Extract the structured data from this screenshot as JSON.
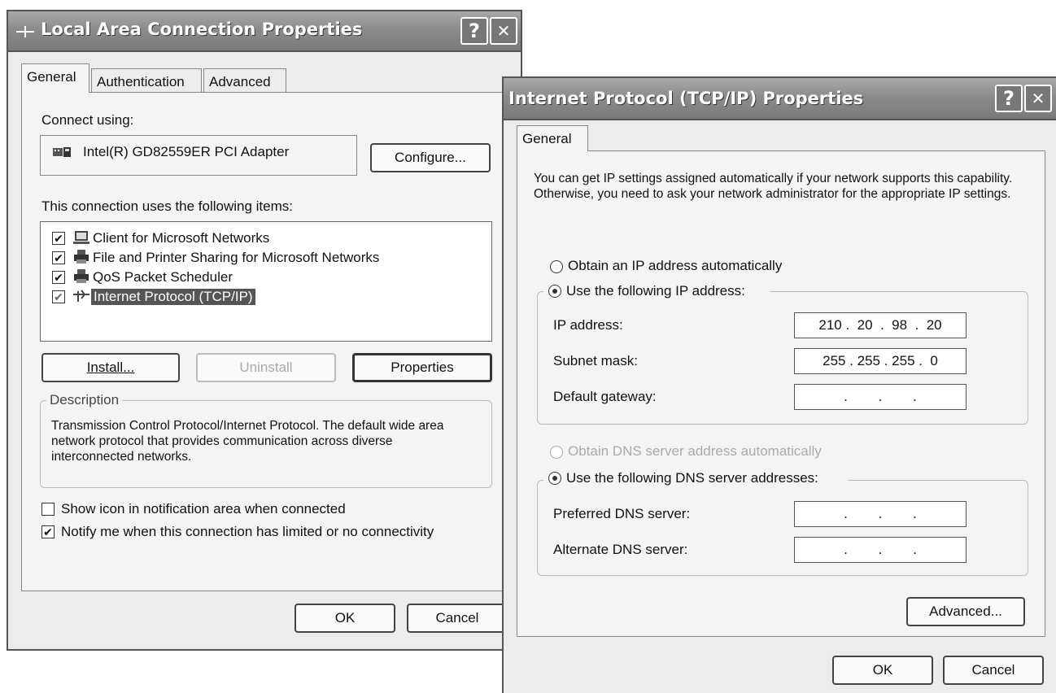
{
  "lac": {
    "title": "Local Area Connection Properties",
    "help_btn": "?",
    "close_btn": "✕",
    "tabs": [
      "General",
      "Authentication",
      "Advanced"
    ],
    "connect_using_label": "Connect using:",
    "adapter_name": "Intel(R) GD82559ER PCI Adapter",
    "configure_btn": "Configure...",
    "items_label": "This connection uses the following items:",
    "items": [
      {
        "label": "Client for Microsoft Networks",
        "checked": true,
        "icon": "computer-icon"
      },
      {
        "label": "File and Printer Sharing for Microsoft Networks",
        "checked": true,
        "icon": "printer-icon"
      },
      {
        "label": "QoS Packet Scheduler",
        "checked": true,
        "icon": "printer-icon"
      },
      {
        "label": "Internet Protocol (TCP/IP)",
        "checked": true,
        "icon": "network-protocol-icon",
        "selected": true
      }
    ],
    "install_btn": "Install...",
    "uninstall_btn": "Uninstall",
    "properties_btn": "Properties",
    "description_legend": "Description",
    "description_text": "Transmission Control Protocol/Internet Protocol. The default wide area network protocol that provides communication across diverse interconnected networks.",
    "show_icon_label": "Show icon in notification area when connected",
    "notify_label": "Notify me when this connection has limited or no connectivity",
    "ok_btn": "OK",
    "cancel_btn": "Cancel"
  },
  "tcp": {
    "title": "Internet Protocol (TCP/IP) Properties",
    "help_btn": "?",
    "close_btn": "✕",
    "tab": "General",
    "intro": "You can get IP settings assigned automatically if your network supports this capability. Otherwise, you need to ask your network administrator for the appropriate IP settings.",
    "obtain_ip_label": "Obtain an IP address automatically",
    "use_ip_label": "Use the following IP address:",
    "ip_label": "IP address:",
    "ip_value": "210 .  20  .  98  .  20",
    "subnet_label": "Subnet mask:",
    "subnet_value": "255 . 255 . 255 .  0",
    "gateway_label": "Default gateway:",
    "gateway_value": ".        .        .",
    "obtain_dns_label": "Obtain DNS server address automatically",
    "use_dns_label": "Use the following DNS server addresses:",
    "preferred_dns_label": "Preferred DNS server:",
    "preferred_dns_value": ".        .        .",
    "alternate_dns_label": "Alternate DNS server:",
    "alternate_dns_value": ".        .        .",
    "advanced_btn": "Advanced...",
    "ok_btn": "OK",
    "cancel_btn": "Cancel"
  }
}
